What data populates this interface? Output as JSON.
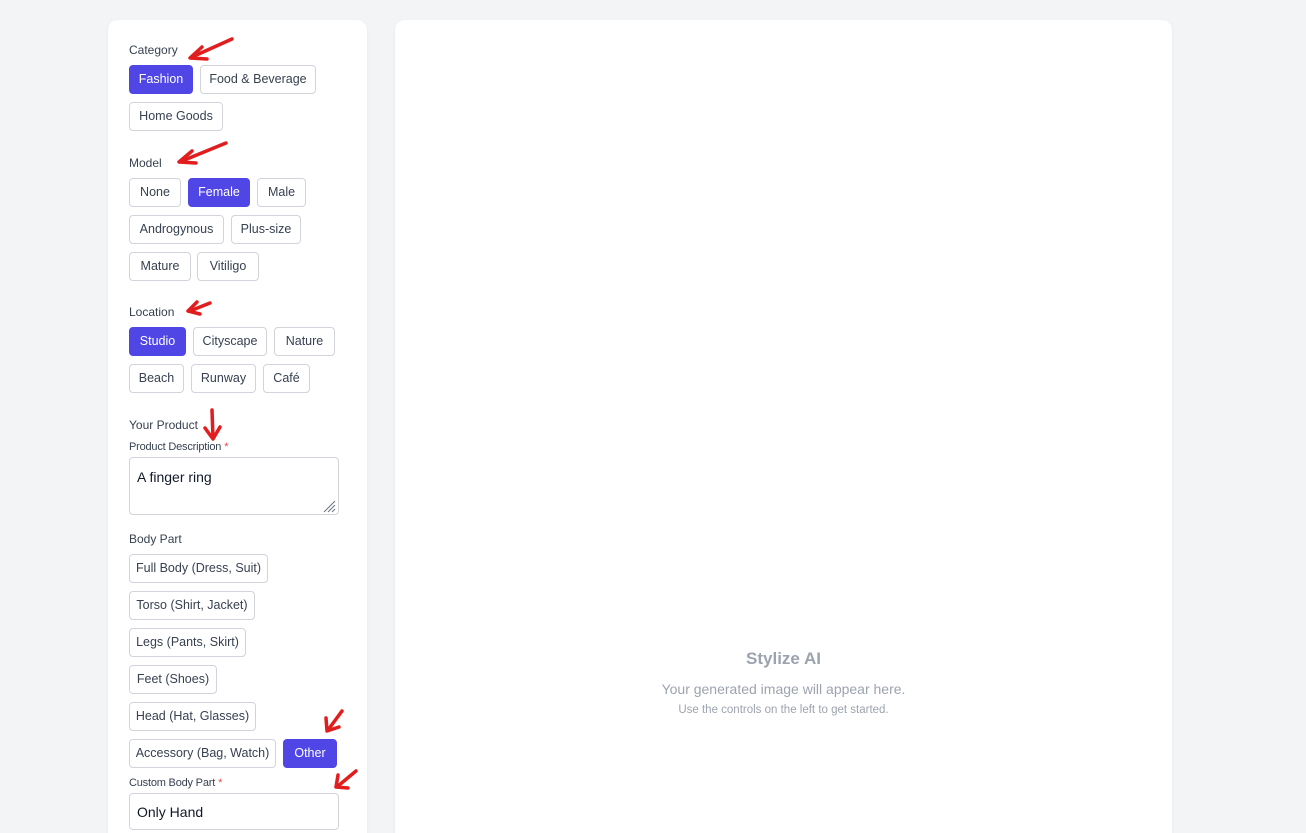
{
  "category": {
    "label": "Category",
    "options": [
      "Fashion",
      "Food & Beverage",
      "Home Goods"
    ],
    "selected": "Fashion"
  },
  "model": {
    "label": "Model",
    "options": [
      "None",
      "Female",
      "Male",
      "Androgynous",
      "Plus-size",
      "Mature",
      "Vitiligo"
    ],
    "selected": "Female"
  },
  "location": {
    "label": "Location",
    "options": [
      "Studio",
      "Cityscape",
      "Nature",
      "Beach",
      "Runway",
      "Café"
    ],
    "selected": "Studio"
  },
  "product": {
    "section_label": "Your Product",
    "description_label": "Product Description",
    "required_mark": "*",
    "description_value": "A finger ring"
  },
  "body_part": {
    "label": "Body Part",
    "options": [
      "Full Body (Dress, Suit)",
      "Torso (Shirt, Jacket)",
      "Legs (Pants, Skirt)",
      "Feet (Shoes)",
      "Head (Hat, Glasses)",
      "Accessory (Bag, Watch)",
      "Other"
    ],
    "selected": "Other",
    "custom_label": "Custom Body Part",
    "custom_required_mark": "*",
    "custom_value": "Only Hand"
  },
  "preview": {
    "title": "Stylize AI",
    "subtitle": "Your generated image will appear here.",
    "hint": "Use the controls on the left to get started."
  },
  "colors": {
    "accent": "#4f46e5",
    "annotation_arrow": "#e11d1d",
    "background": "#f3f4f6"
  }
}
